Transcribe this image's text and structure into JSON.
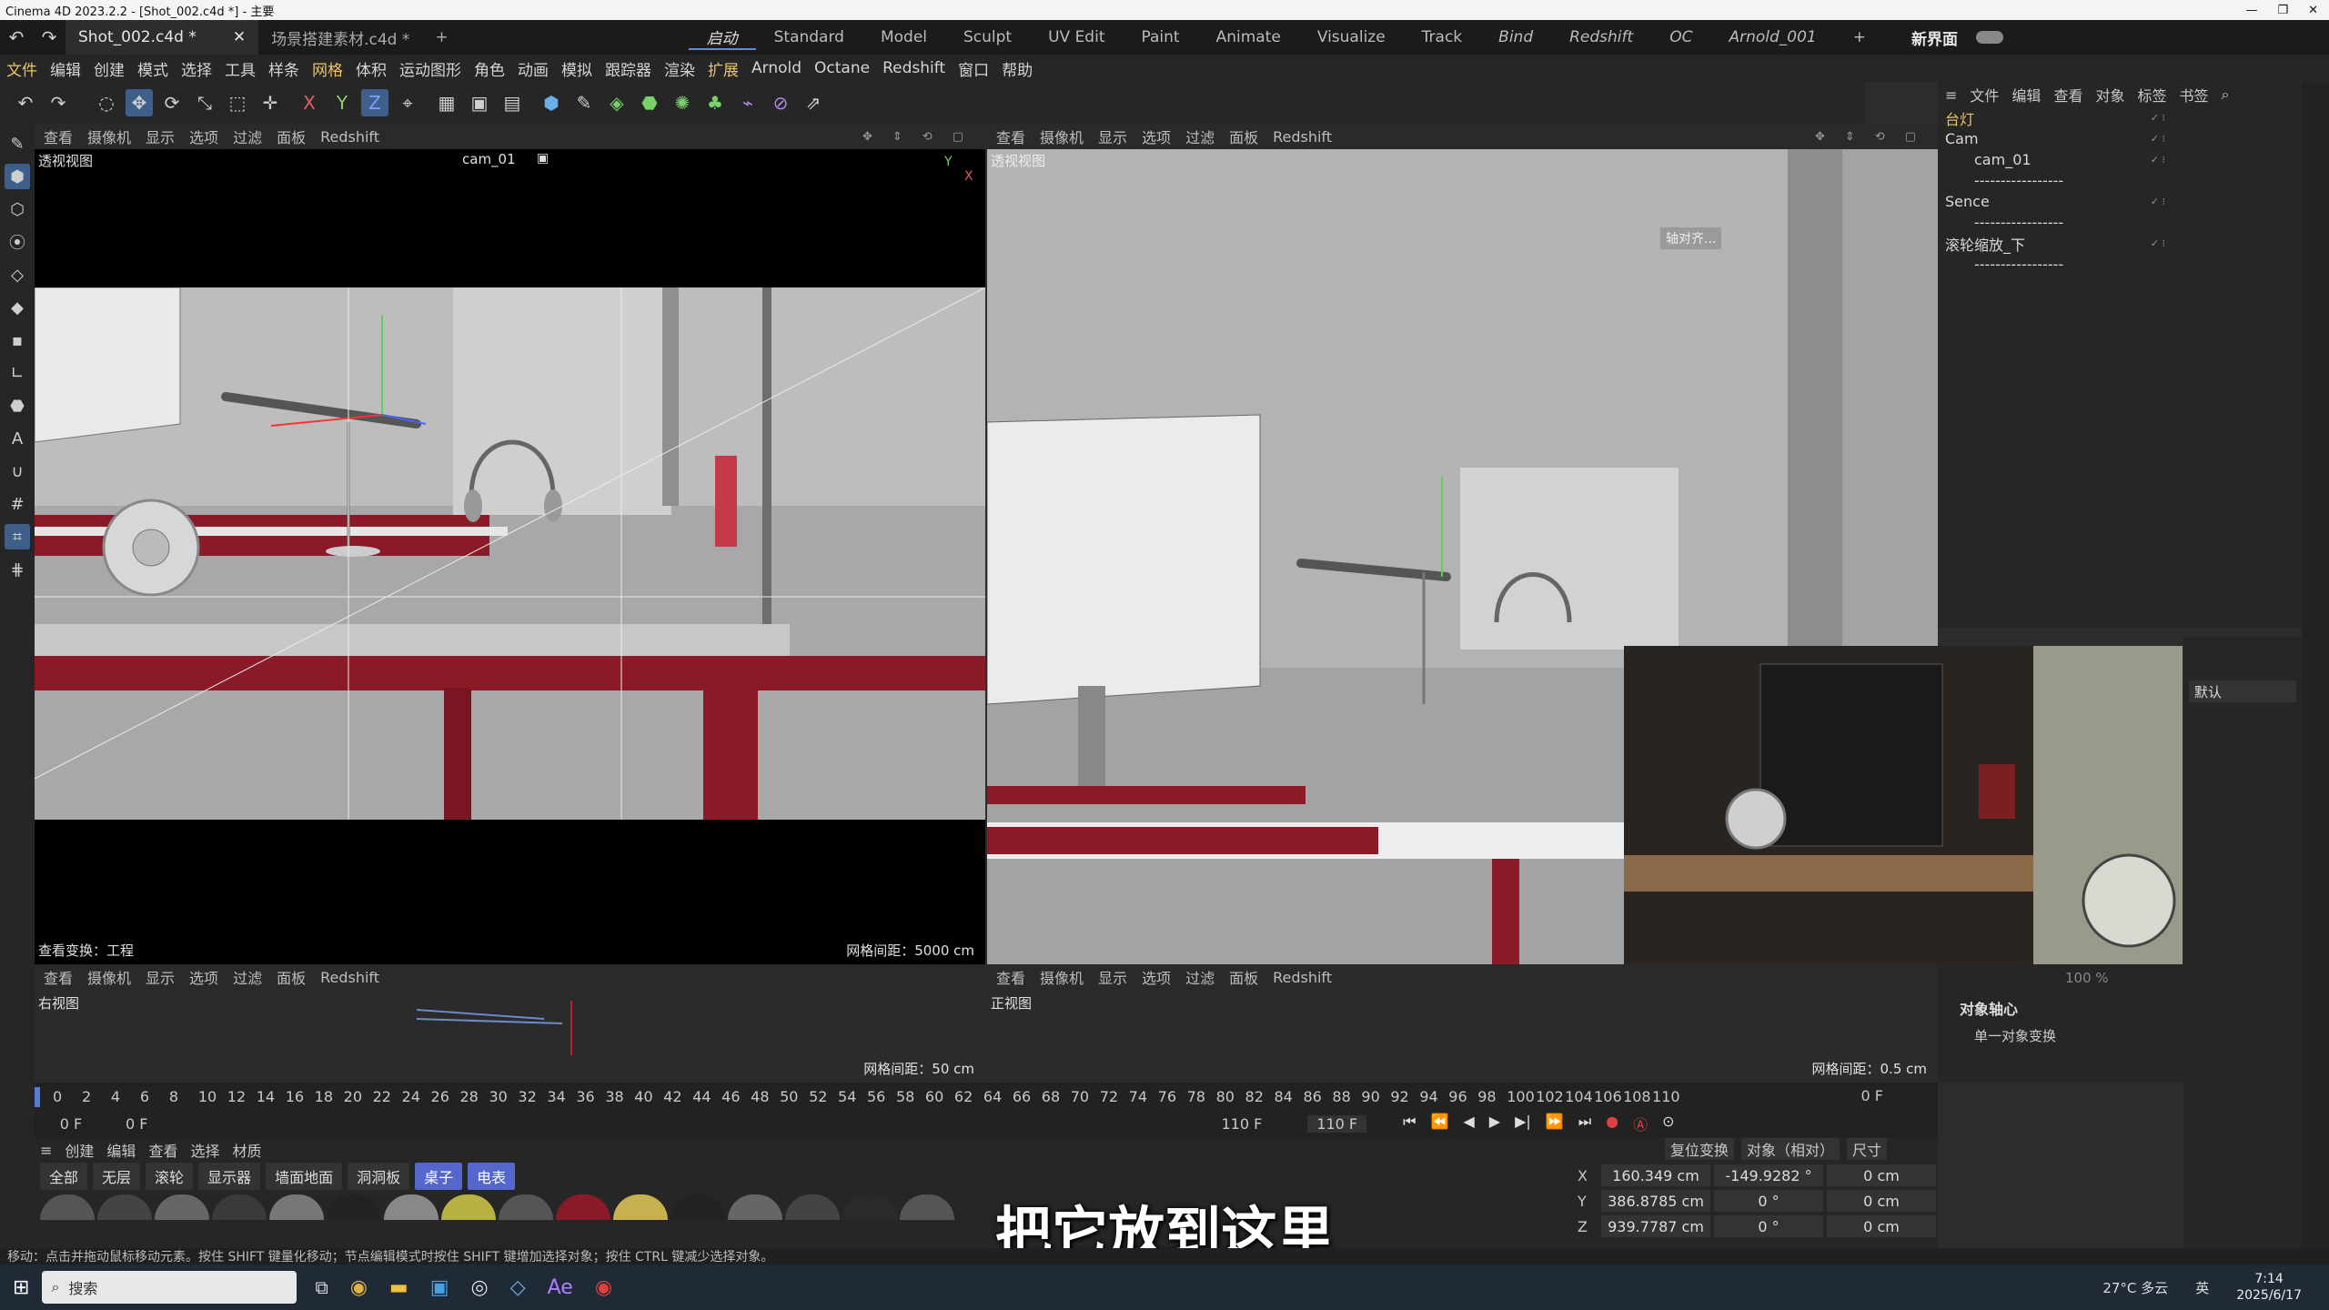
{
  "window": {
    "title": "Cinema 4D 2023.2.2 - [Shot_002.c4d *] - 主要"
  },
  "tabs": [
    {
      "label": "Shot_002.c4d *"
    },
    {
      "label": "场景搭建素材.c4d *"
    }
  ],
  "layouts": [
    "启动",
    "Standard",
    "Model",
    "Sculpt",
    "UV Edit",
    "Paint",
    "Animate",
    "Visualize",
    "Track",
    "Bind",
    "Redshift",
    "OC",
    "Arnold_001"
  ],
  "new_layout_label": "新界面",
  "menu": [
    "文件",
    "编辑",
    "创建",
    "模式",
    "选择",
    "工具",
    "样条",
    "网格",
    "体积",
    "运动图形",
    "角色",
    "动画",
    "模拟",
    "跟踪器",
    "渲染",
    "扩展",
    "Arnold",
    "Octane",
    "Redshift",
    "窗口",
    "帮助"
  ],
  "viewport_menu": [
    "查看",
    "摄像机",
    "显示",
    "选项",
    "过滤",
    "面板",
    "Redshift"
  ],
  "viewports": {
    "persp": {
      "label": "透视视图",
      "camera": "cam_01",
      "footer_left": "查看变换：工程",
      "grid": "网格间距：5000 cm"
    },
    "persp2": {
      "label": "透视视图",
      "hint": "轴对齐..."
    },
    "right": {
      "label": "右视图",
      "grid": "网格间距：50 cm"
    },
    "front": {
      "label": "正视图",
      "grid": "网格间距：0.5 cm"
    }
  },
  "object_manager": {
    "menu": [
      "文件",
      "编辑",
      "查看",
      "对象",
      "标签",
      "书签"
    ],
    "objects": [
      {
        "name": "台灯",
        "color": "#e9c46a"
      },
      {
        "name": "Cam",
        "color": "#d8d8d8"
      },
      {
        "name": "cam_01",
        "color": "#d8d8d8"
      },
      {
        "name": "-----------------",
        "color": "#bbbbbb"
      },
      {
        "name": "Sence",
        "color": "#d8d8d8"
      },
      {
        "name": "-----------------",
        "color": "#bbbbbb"
      },
      {
        "name": "滚轮缩放_下",
        "color": "#d8d8d8"
      },
      {
        "name": "-----------------",
        "color": "#bbbbbb"
      }
    ]
  },
  "attributes": {
    "preset": "默认",
    "section": "对象轴心",
    "option": "单一对象变换",
    "zoom": "100 %"
  },
  "timeline": {
    "ticks": [
      "0",
      "2",
      "4",
      "6",
      "8",
      "10",
      "12",
      "14",
      "16",
      "18",
      "20",
      "22",
      "24",
      "26",
      "28",
      "30",
      "32",
      "34",
      "36",
      "38",
      "40",
      "42",
      "44",
      "46",
      "48",
      "50",
      "52",
      "54",
      "56",
      "58",
      "60",
      "62",
      "64",
      "66",
      "68",
      "70",
      "72",
      "74",
      "76",
      "78",
      "80",
      "82",
      "84",
      "86",
      "88",
      "90",
      "92",
      "94",
      "96",
      "98",
      "100",
      "102",
      "104",
      "106",
      "108",
      "110"
    ],
    "current_frame": "0 F",
    "start": "0 F",
    "start2": "0 F",
    "end": "110 F",
    "end2": "110 F",
    "right_frame": "0 F"
  },
  "materials": {
    "menu": [
      "创建",
      "编辑",
      "查看",
      "选择",
      "材质"
    ],
    "tabs": [
      "全部",
      "无层",
      "滚轮",
      "显示器",
      "墙面地面",
      "洞洞板",
      "桌子",
      "电表"
    ],
    "active_tabs": [
      "桌子",
      "电表"
    ]
  },
  "coordinates": {
    "header": [
      "复位变换",
      "对象（相对）",
      "尺寸"
    ],
    "rows": [
      {
        "axis": "X",
        "pos": "160.349 cm",
        "rot": "-149.9282 °",
        "size": "0 cm"
      },
      {
        "axis": "Y",
        "pos": "386.8785 cm",
        "rot": "0 °",
        "size": "0 cm"
      },
      {
        "axis": "Z",
        "pos": "939.7787 cm",
        "rot": "0 °",
        "size": "0 cm"
      }
    ]
  },
  "status": "移动：点击并拖动鼠标移动元素。按住 SHIFT 键量化移动；节点编辑模式时按住 SHIFT 键增加选择对象；按住 CTRL 键减少选择对象。",
  "subtitle": "把它放到这里",
  "taskbar": {
    "search": "搜索",
    "weather": "27°C 多云",
    "time": "7:14",
    "date": "2025/6/17",
    "lang": "英"
  }
}
